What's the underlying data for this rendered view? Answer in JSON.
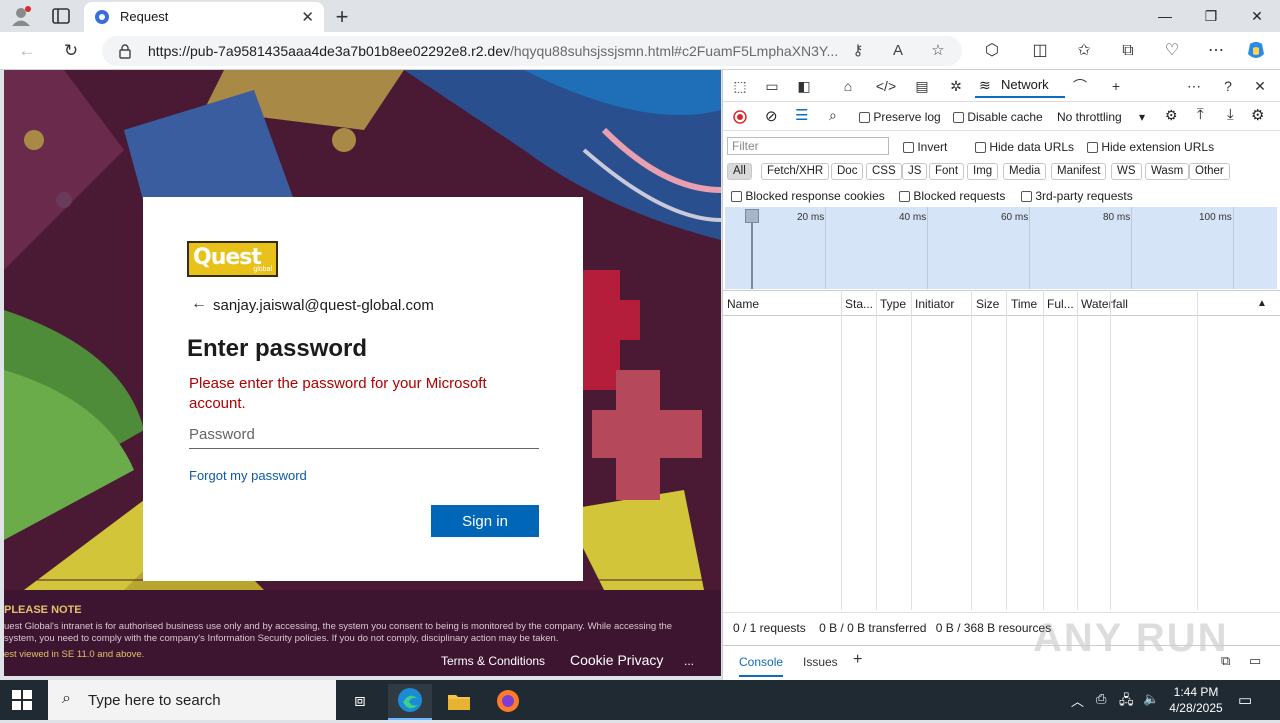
{
  "browser": {
    "tab_title": "Request",
    "url_host": "https://pub-7a9581435aaa4de3a7b01b8ee02292e8.r2.dev",
    "url_path": "/hqyqu88suhsjssjsmn.html#c2FuamF5LmphaXN3Y..."
  },
  "login": {
    "email": "sanjay.jaiswal@quest-global.com",
    "heading": "Enter password",
    "error": "Please enter the password for your Microsoft account.",
    "password_placeholder": "Password",
    "forgot_link": "Forgot my password",
    "signin_button": "Sign in",
    "logo_word": "Quest",
    "logo_sub": "global"
  },
  "page_footer": {
    "note_title": "PLEASE NOTE",
    "note_text": "uest Global's intranet is for authorised business use only and by accessing, the system you consent to being is monitored by the company. While accessing the system, you need to comply with the company's Information Security policies. If you do not comply, disciplinary action may be taken.",
    "note_seen": "est viewed in SE 11.0 and above.",
    "terms": "Terms & Conditions",
    "cookie": "Cookie Privacy",
    "more": "..."
  },
  "devtools": {
    "active_tab": "Network",
    "preserve_log": "Preserve log",
    "disable_cache": "Disable cache",
    "throttling": "No throttling",
    "filter_placeholder": "Filter",
    "invert": "Invert",
    "hide_data_urls": "Hide data URLs",
    "hide_extension_urls": "Hide extension URLs",
    "chips": [
      "All",
      "Fetch/XHR",
      "Doc",
      "CSS",
      "JS",
      "Font",
      "Img",
      "Media",
      "Manifest",
      "WS",
      "Wasm",
      "Other"
    ],
    "blocked_cookies": "Blocked response cookies",
    "blocked_requests": "Blocked requests",
    "third_party": "3rd-party requests",
    "timeline_ticks": [
      "20 ms",
      "40 ms",
      "60 ms",
      "80 ms",
      "100 ms"
    ],
    "columns": [
      "Name",
      "Sta...",
      "Type",
      "Initiator",
      "Size",
      "Time",
      "Ful...",
      "Waterfall"
    ],
    "status_requests": "0 / 1 requests",
    "status_transferred": "0 B / 0 B transferred",
    "status_resources": "0 B / 368 B resources",
    "drawer_console": "Console",
    "drawer_issues": "Issues",
    "watermark": "ANY RUN"
  },
  "taskbar": {
    "search_placeholder": "Type here to search",
    "time": "1:44 PM",
    "date": "4/28/2025"
  }
}
